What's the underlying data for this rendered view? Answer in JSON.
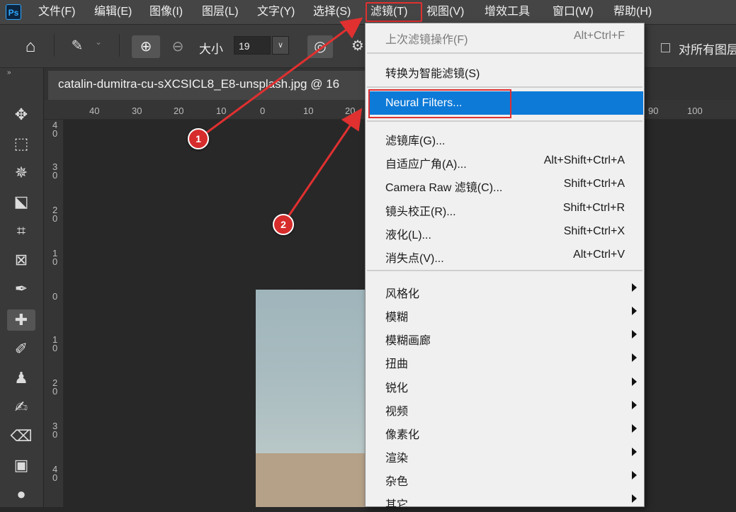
{
  "app": {
    "logo": "Ps"
  },
  "menubar": {
    "items": [
      {
        "label": "文件(F)"
      },
      {
        "label": "编辑(E)"
      },
      {
        "label": "图像(I)"
      },
      {
        "label": "图层(L)"
      },
      {
        "label": "文字(Y)"
      },
      {
        "label": "选择(S)"
      },
      {
        "label": "滤镜(T)"
      },
      {
        "label": "视图(V)"
      },
      {
        "label": "增效工具"
      },
      {
        "label": "窗口(W)"
      },
      {
        "label": "帮助(H)"
      }
    ]
  },
  "options": {
    "size_label": "大小",
    "size_value": "19",
    "all_layers_label": "对所有图层"
  },
  "document": {
    "tab_title": "catalin-dumitra-cu-sXCSICL8_E8-unsplash.jpg @ 16"
  },
  "ruler": {
    "h_ticks": [
      "40",
      "30",
      "20",
      "10",
      "0",
      "10",
      "20",
      "90",
      "100"
    ],
    "v_ticks": [
      "4\n0",
      "3\n0",
      "2\n0",
      "1\n0",
      "0",
      "1\n0",
      "2\n0",
      "3\n0",
      "4\n0"
    ]
  },
  "filter_menu": {
    "items": [
      {
        "label": "上次滤镜操作(F)",
        "shortcut": "Alt+Ctrl+F",
        "disabled": true
      },
      {
        "label": "转换为智能滤镜(S)",
        "shortcut": ""
      },
      {
        "label": "Neural Filters...",
        "shortcut": "",
        "highlighted": true
      },
      {
        "label": "滤镜库(G)...",
        "shortcut": ""
      },
      {
        "label": "自适应广角(A)...",
        "shortcut": "Alt+Shift+Ctrl+A"
      },
      {
        "label": "Camera Raw 滤镜(C)...",
        "shortcut": "Shift+Ctrl+A"
      },
      {
        "label": "镜头校正(R)...",
        "shortcut": "Shift+Ctrl+R"
      },
      {
        "label": "液化(L)...",
        "shortcut": "Shift+Ctrl+X"
      },
      {
        "label": "消失点(V)...",
        "shortcut": "Alt+Ctrl+V"
      },
      {
        "label": "风格化",
        "submenu": true
      },
      {
        "label": "模糊",
        "submenu": true
      },
      {
        "label": "模糊画廊",
        "submenu": true
      },
      {
        "label": "扭曲",
        "submenu": true
      },
      {
        "label": "锐化",
        "submenu": true
      },
      {
        "label": "视频",
        "submenu": true
      },
      {
        "label": "像素化",
        "submenu": true
      },
      {
        "label": "渲染",
        "submenu": true
      },
      {
        "label": "杂色",
        "submenu": true
      },
      {
        "label": "其它",
        "submenu": true
      }
    ]
  },
  "annotations": [
    {
      "label": "1"
    },
    {
      "label": "2"
    }
  ],
  "colors": {
    "accent_highlight": "#0d7ad8",
    "annotation_red": "#e03030"
  }
}
